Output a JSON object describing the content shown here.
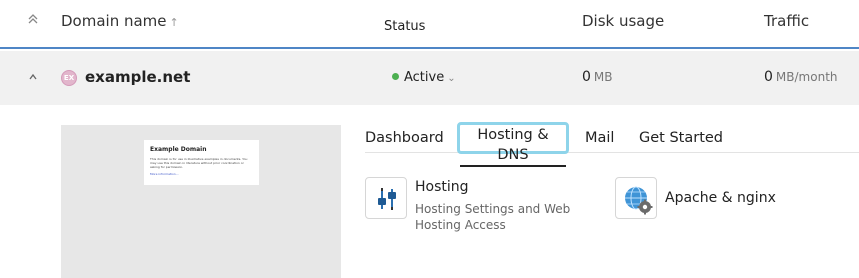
{
  "header": {
    "collapse_all_icon": "double-chevron-up-icon",
    "domain_name_label": "Domain name",
    "sort_icon": "arrow-up-icon",
    "status_label": "Status",
    "disk_usage_label": "Disk usage",
    "traffic_label": "Traffic"
  },
  "domain": {
    "toggle_icon": "chevron-up-icon",
    "avatar_initials": "EX",
    "name": "example.net",
    "status": "Active",
    "status_color": "#4caf50",
    "disk_value": "0",
    "disk_unit": "MB",
    "traffic_value": "0",
    "traffic_unit": "MB/month"
  },
  "preview": {
    "title": "Example Domain",
    "text": "This domain is for use in illustrative examples in documents. You may use this domain in literature without prior coordination or asking for permission.",
    "link": "More information..."
  },
  "tabs": [
    {
      "label": "Dashboard"
    },
    {
      "label": "Hosting & DNS",
      "active": true
    },
    {
      "label": "Mail"
    },
    {
      "label": "Get Started"
    }
  ],
  "tools": {
    "hosting": {
      "icon": "sliders-icon",
      "title": "Hosting",
      "description": "Hosting Settings and Web Hosting Access"
    },
    "apache": {
      "icon": "globe-gear-icon",
      "title": "Apache & nginx"
    }
  },
  "colors": {
    "accent_border": "#4f86c6",
    "tab_focus": "#8ed4ea"
  }
}
